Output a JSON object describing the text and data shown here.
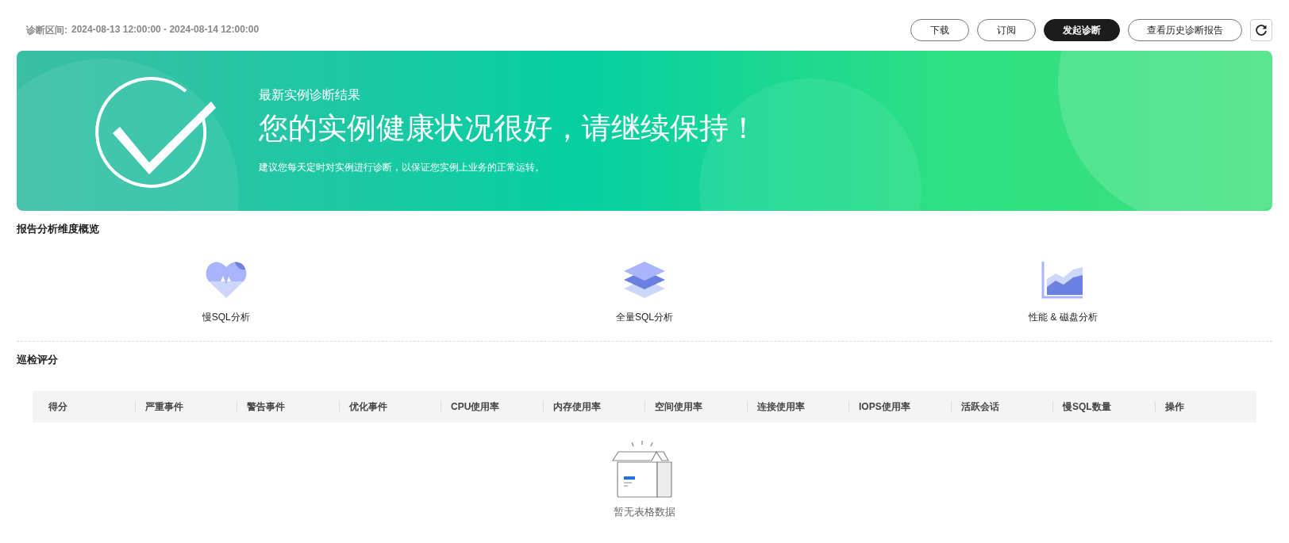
{
  "toolbar": {
    "range_label": "诊断区间:",
    "range_value": "2024-08-13 12:00:00 - 2024-08-14 12:00:00",
    "buttons": [
      {
        "label": "下载",
        "kind": "default"
      },
      {
        "label": "订阅",
        "kind": "default"
      },
      {
        "label": "发起诊断",
        "kind": "primary"
      },
      {
        "label": "查看历史诊断报告",
        "kind": "default"
      }
    ]
  },
  "banner": {
    "subtitle": "最新实例诊断结果",
    "title": "您的实例健康状况很好，请继续保持！",
    "note": "建议您每天定时对实例进行诊断，以保证您实例上业务的正常运转。"
  },
  "overview": {
    "title": "报告分析维度概览",
    "items": [
      {
        "label": "慢SQL分析",
        "kind": "heart"
      },
      {
        "label": "全量SQL分析",
        "kind": "layers"
      },
      {
        "label": "性能 & 磁盘分析",
        "kind": "area"
      }
    ]
  },
  "inspection": {
    "title": "巡检评分",
    "table": {
      "columns": [
        "得分",
        "严重事件",
        "警告事件",
        "优化事件",
        "CPU使用率",
        "内存使用率",
        "空间使用率",
        "连接使用率",
        "IOPS使用率",
        "活跃会话",
        "慢SQL数量",
        "操作"
      ]
    },
    "empty_text": "暂无表格数据"
  }
}
